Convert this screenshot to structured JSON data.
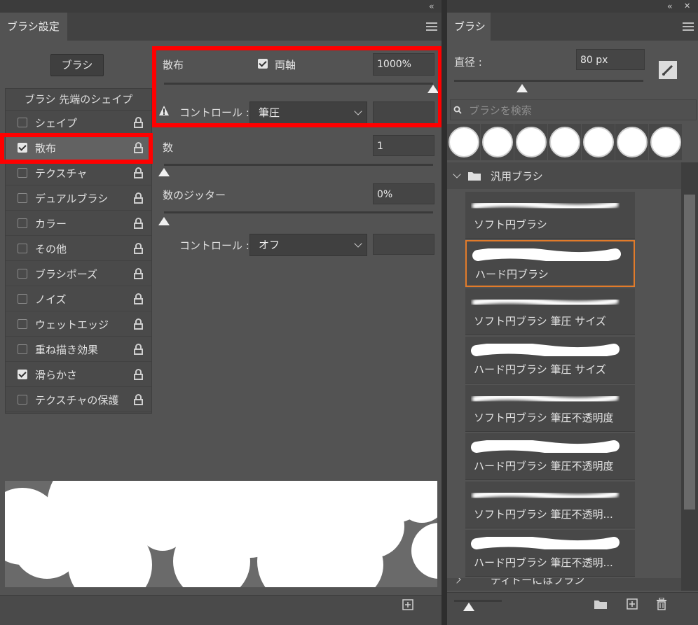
{
  "left_panel": {
    "tab_title": "ブラシ設定",
    "brush_button": "ブラシ",
    "list_header": "ブラシ 先端のシェイプ",
    "options": [
      {
        "label": "シェイプ",
        "checked": false
      },
      {
        "label": "散布",
        "checked": true,
        "selected": true
      },
      {
        "label": "テクスチャ",
        "checked": false
      },
      {
        "label": "デュアルブラシ",
        "checked": false
      },
      {
        "label": "カラー",
        "checked": false
      },
      {
        "label": "その他",
        "checked": false
      },
      {
        "label": "ブラシポーズ",
        "checked": false
      },
      {
        "label": "ノイズ",
        "checked": false
      },
      {
        "label": "ウェットエッジ",
        "checked": false
      },
      {
        "label": "重ね描き効果",
        "checked": false
      },
      {
        "label": "滑らかさ",
        "checked": true
      },
      {
        "label": "テクスチャの保護",
        "checked": false
      }
    ]
  },
  "scatter": {
    "label": "散布",
    "both_axes_label": "両軸",
    "both_axes_checked": true,
    "value": "1000%",
    "slider_fraction": 1.0,
    "control_label": "コントロール :",
    "control_value": "筆圧",
    "warning_icon": "warning-icon"
  },
  "count": {
    "label": "数",
    "value": "1",
    "slider_fraction": 0.0
  },
  "count_jitter": {
    "label": "数のジッター",
    "value": "0%",
    "slider_fraction": 0.0,
    "control_label": "コントロール :",
    "control_value": "オフ"
  },
  "right_panel": {
    "tab_title": "ブラシ",
    "diameter_label": "直径 :",
    "diameter_value": "80 px",
    "search_placeholder": "ブラシを検索",
    "group_name": "汎用ブラシ",
    "next_group_partial": "ティドーにはブラン",
    "brushes": [
      {
        "name": "ソフト円ブラシ",
        "type": "soft"
      },
      {
        "name": "ハード円ブラシ",
        "type": "hard",
        "selected": true
      },
      {
        "name": "ソフト円ブラシ 筆圧 サイズ",
        "type": "soft"
      },
      {
        "name": "ハード円ブラシ 筆圧 サイズ",
        "type": "hard"
      },
      {
        "name": "ソフト円ブラシ 筆圧不透明度",
        "type": "soft"
      },
      {
        "name": "ハード円ブラシ 筆圧不透明度",
        "type": "hard"
      },
      {
        "name": "ソフト円ブラシ 筆圧不透明...",
        "type": "soft"
      },
      {
        "name": "ハード円ブラシ 筆圧不透明...",
        "type": "hard"
      }
    ]
  },
  "colors": {
    "panel": "#535353",
    "highlight": "#ff0000",
    "selection": "#e27b2a"
  }
}
